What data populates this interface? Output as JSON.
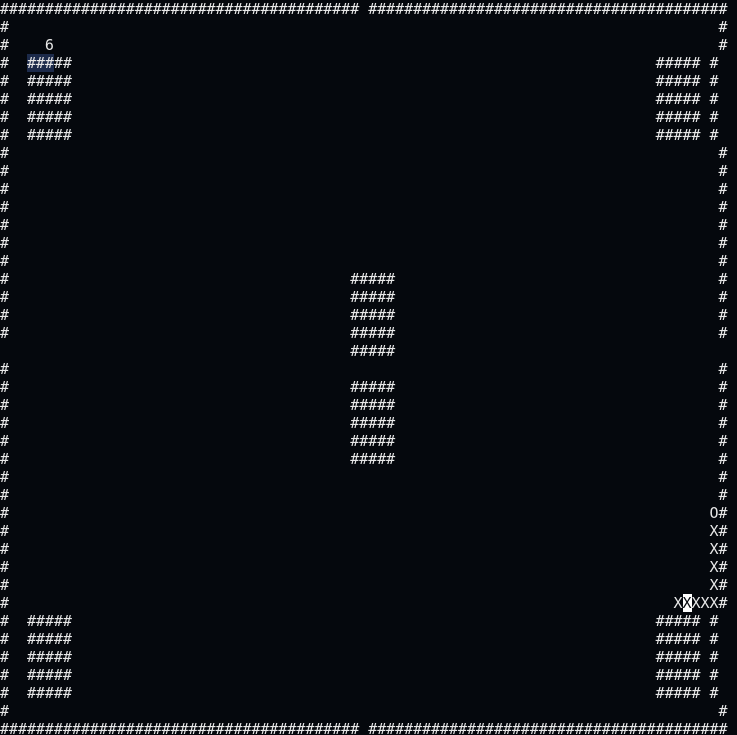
{
  "game": {
    "score_label": "6",
    "symbols": {
      "wall": "#",
      "snake_head": "O",
      "snake_body": "X"
    },
    "board_rows": [
      "######################################## ########################################",
      "#                                                                               #",
      "#    6                                                                          #",
      "#  #####                                                                 ##### #",
      "#  #####                                                                 ##### #",
      "#  #####                                                                 ##### #",
      "#  #####                                                                 ##### #",
      "#  #####                                                                 ##### #",
      "#                                                                               #",
      "#                                                                               #",
      "#                                                                               #",
      "#                                                                               #",
      "#                                                                               #",
      "#                                                                               #",
      "#                                                                               #",
      "#                                      #####                                    #",
      "#                                      #####                                    #",
      "#                                      #####                                    #",
      "#                                      #####                                    #",
      "                                       #####                                     ",
      "#                                                                               #",
      "#                                      #####                                    #",
      "#                                      #####                                    #",
      "#                                      #####                                    #",
      "#                                      #####                                    #",
      "#                                      #####                                    #",
      "#                                                                               #",
      "#                                                                               #",
      "#                                                                              O#",
      "#                                                                              X#",
      "#                                                                              X#",
      "#                                                                              X#",
      "#                                                                              X#",
      "#                                                                          XXXXX#",
      "#  #####                                                                 ##### #",
      "#  #####                                                                 ##### #",
      "#  #####                                                                 ##### #",
      "#  #####                                                                 ##### #",
      "#  #####                                                                 ##### #",
      "#                                                                               #",
      "######################################## ########################################"
    ]
  }
}
